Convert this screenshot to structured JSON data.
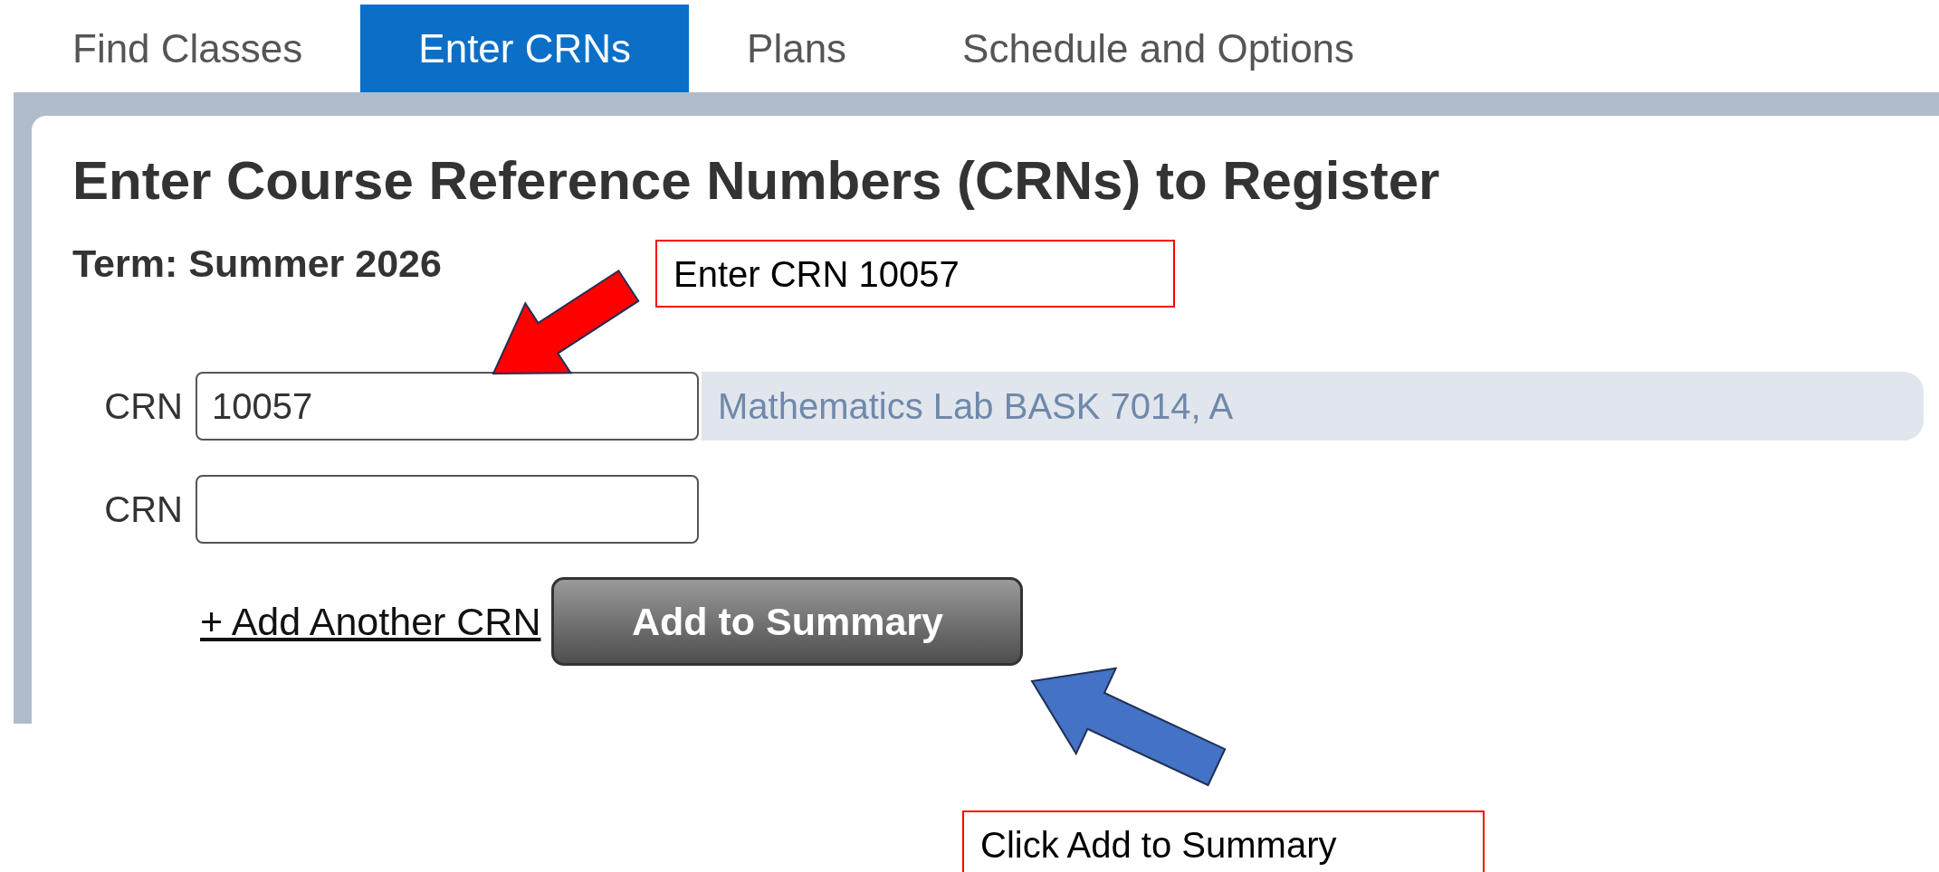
{
  "tabs": [
    {
      "label": "Find Classes",
      "selected": false
    },
    {
      "label": "Enter CRNs",
      "selected": true
    },
    {
      "label": "Plans",
      "selected": false
    },
    {
      "label": "Schedule and Options",
      "selected": false
    }
  ],
  "heading": "Enter Course Reference Numbers (CRNs) to Register",
  "term": "Term: Summer 2026",
  "crn_rows": [
    {
      "label": "CRN",
      "value": "10057",
      "course": "Mathematics Lab BASK 7014, A"
    },
    {
      "label": "CRN"
    }
  ],
  "add_link": "+ Add Another CRN",
  "add_button": "Add to Summary",
  "annotations": [
    {
      "text": "Enter CRN 10057",
      "color": "#ff0000"
    },
    {
      "text": "Click Add to Summary",
      "color": "#4472c4"
    }
  ]
}
